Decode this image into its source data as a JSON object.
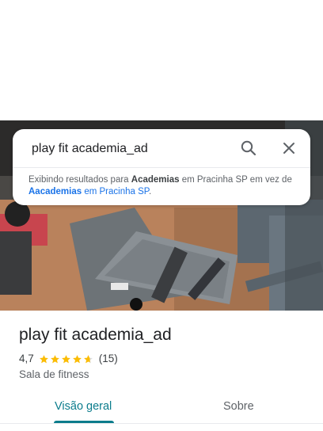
{
  "search": {
    "query": "play fit academia_ad",
    "notice": {
      "prefix": "Exibindo resultados para ",
      "term": "Academias",
      "middle": " em Pracinha SP em vez de ",
      "orig_term": "Aacademias",
      "orig_suffix": " em Pracinha SP",
      "end": "."
    }
  },
  "place": {
    "name": "play fit academia_ad",
    "rating": "4,7",
    "rating_value": 4.7,
    "reviews": "(15)",
    "category": "Sala de fitness"
  },
  "tabs": [
    {
      "label": "Visão geral",
      "active": true
    },
    {
      "label": "Sobre",
      "active": false
    }
  ],
  "colors": {
    "accent": "#0b7c8c",
    "star": "#fbbc04",
    "link": "#1a73e8"
  },
  "icons": {
    "search": "search-icon",
    "close": "close-icon"
  }
}
